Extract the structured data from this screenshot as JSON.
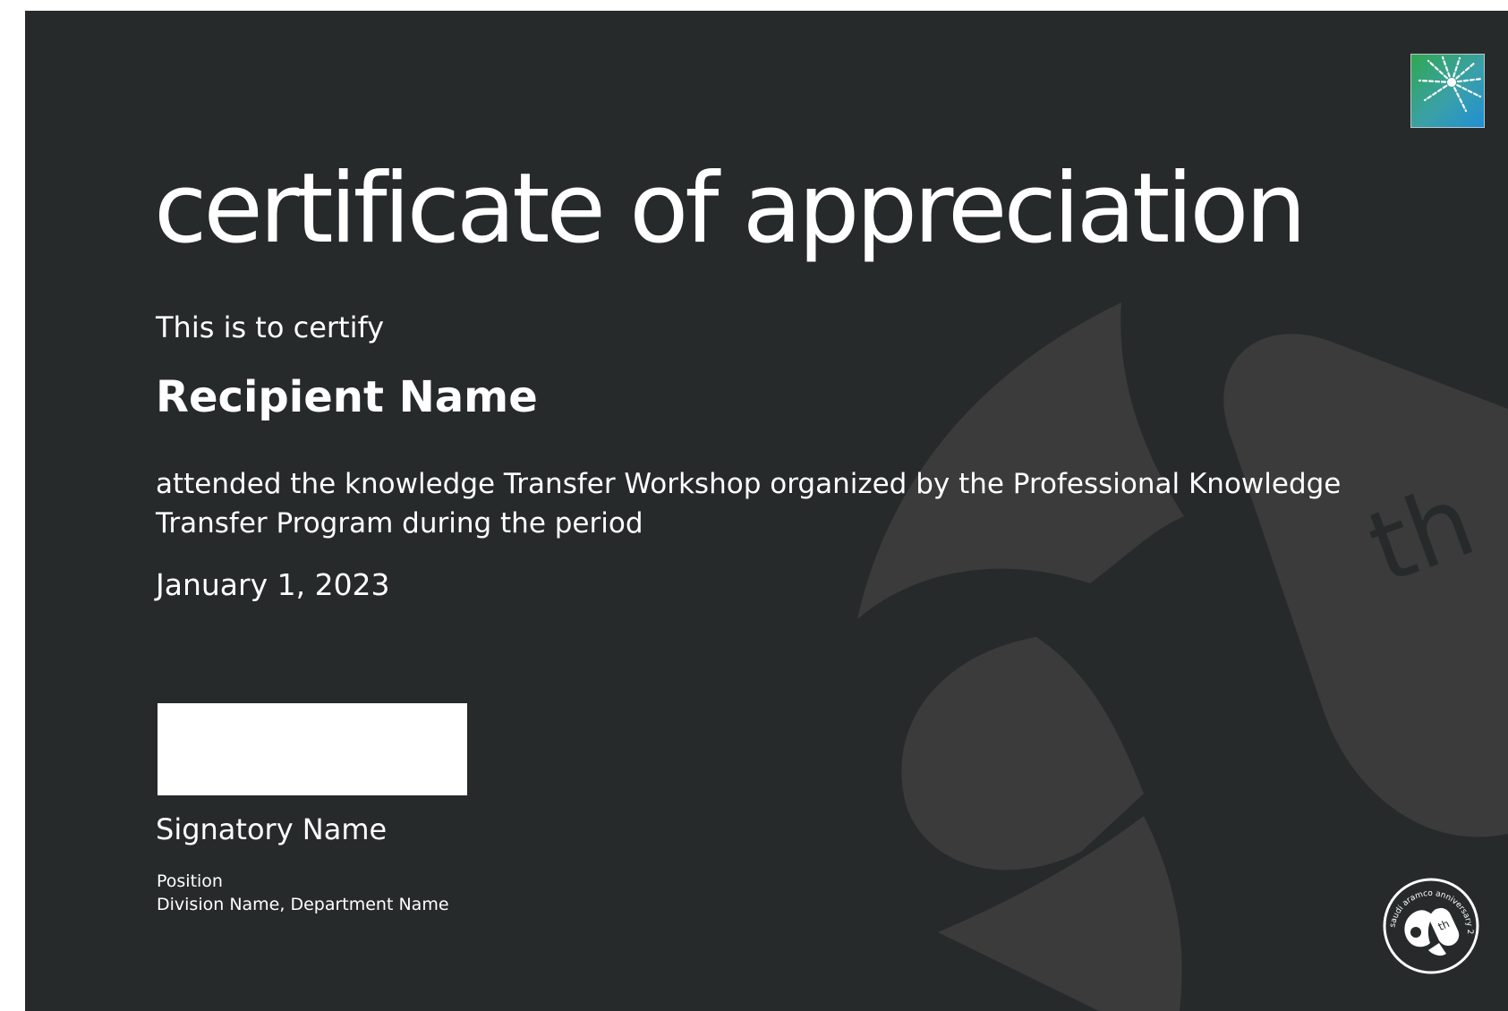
{
  "certificate": {
    "title": "certificate of appreciation",
    "intro": "This is to certify",
    "recipient_name": "Recipient Name",
    "body_text": "attended the knowledge Transfer Workshop organized by the Professional Knowledge Transfer Program during the period",
    "date": "January 1, 2023",
    "signatory_name": "Signatory Name",
    "position": "Position",
    "division_department": "Division Name, Department Name"
  },
  "branding": {
    "logo_icon": "saudi-aramco-logo",
    "badge_icon": "aramco-anniversary-badge",
    "badge_text": "saudi aramco anniversary 2023",
    "badge_center_text": "th",
    "watermark_text": "th"
  },
  "colors": {
    "background": "#262a2b",
    "watermark": "#3b3b3c",
    "text": "#ffffff",
    "logo_green": "#2fa84f",
    "logo_blue": "#1f8fd6"
  }
}
